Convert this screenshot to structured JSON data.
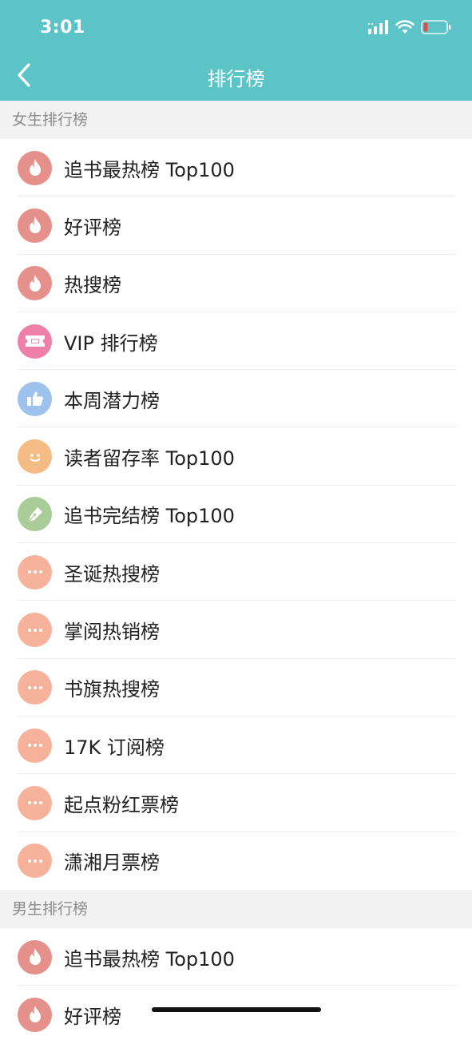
{
  "status_bar": {
    "time": "3:01",
    "battery_color": "#e94b4b"
  },
  "nav": {
    "title": "排行榜"
  },
  "colors": {
    "header": "#5cc4c7",
    "fire": "#e5908a",
    "vip": "#ee7fa8",
    "thumb": "#9dc2ee",
    "smile": "#f5bb85",
    "pen": "#a9cc98",
    "more": "#f6b29b"
  },
  "sections": [
    {
      "title": "女生排行榜",
      "items": [
        {
          "label": "追书最热榜 Top100",
          "icon": "fire-icon"
        },
        {
          "label": "好评榜",
          "icon": "fire-icon"
        },
        {
          "label": "热搜榜",
          "icon": "fire-icon"
        },
        {
          "label": "VIP 排行榜",
          "icon": "vip-ticket-icon"
        },
        {
          "label": "本周潜力榜",
          "icon": "thumbs-up-icon"
        },
        {
          "label": "读者留存率 Top100",
          "icon": "smile-icon"
        },
        {
          "label": "追书完结榜 Top100",
          "icon": "pen-icon"
        },
        {
          "label": "圣诞热搜榜",
          "icon": "more-icon"
        },
        {
          "label": "掌阅热销榜",
          "icon": "more-icon"
        },
        {
          "label": "书旗热搜榜",
          "icon": "more-icon"
        },
        {
          "label": "17K 订阅榜",
          "icon": "more-icon"
        },
        {
          "label": "起点粉红票榜",
          "icon": "more-icon"
        },
        {
          "label": "潇湘月票榜",
          "icon": "more-icon"
        }
      ]
    },
    {
      "title": "男生排行榜",
      "items": [
        {
          "label": "追书最热榜 Top100",
          "icon": "fire-icon"
        },
        {
          "label": "好评榜",
          "icon": "fire-icon"
        }
      ]
    }
  ]
}
